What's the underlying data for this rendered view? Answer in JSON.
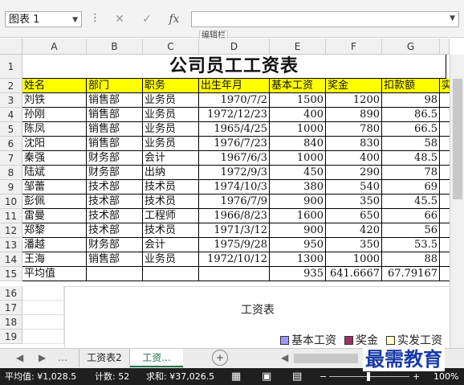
{
  "namebox": "图表 1",
  "formula_tooltip": "编辑栏",
  "formula_buttons": [
    "✕",
    "✓",
    "fx"
  ],
  "columns": [
    "A",
    "B",
    "C",
    "D",
    "E",
    "F",
    "G"
  ],
  "title": "公司员工工资表",
  "headers": [
    "姓名",
    "部门",
    "职务",
    "出生年月",
    "基本工资",
    "奖金",
    "扣款额",
    "实"
  ],
  "rows": [
    [
      "刘铁",
      "销售部",
      "业务员",
      "1970/7/2",
      "1500",
      "1200",
      "98"
    ],
    [
      "孙刚",
      "销售部",
      "业务员",
      "1972/12/23",
      "400",
      "890",
      "86.5"
    ],
    [
      "陈凤",
      "销售部",
      "业务员",
      "1965/4/25",
      "1000",
      "780",
      "66.5"
    ],
    [
      "沈阳",
      "销售部",
      "业务员",
      "1976/7/23",
      "840",
      "830",
      "58"
    ],
    [
      "秦强",
      "财务部",
      "会计",
      "1967/6/3",
      "1000",
      "400",
      "48.5"
    ],
    [
      "陆斌",
      "财务部",
      "出纳",
      "1972/9/3",
      "450",
      "290",
      "78"
    ],
    [
      "邹蕾",
      "技术部",
      "技术员",
      "1974/10/3",
      "380",
      "540",
      "69"
    ],
    [
      "彭佩",
      "技术部",
      "技术员",
      "1976/7/9",
      "900",
      "350",
      "45.5"
    ],
    [
      "雷曼",
      "技术部",
      "工程师",
      "1966/8/23",
      "1600",
      "650",
      "66"
    ],
    [
      "郑黎",
      "技术部",
      "技术员",
      "1971/3/12",
      "900",
      "420",
      "56"
    ],
    [
      "潘越",
      "财务部",
      "会计",
      "1975/9/28",
      "950",
      "350",
      "53.5"
    ],
    [
      "王海",
      "销售部",
      "业务员",
      "1972/10/12",
      "1300",
      "1000",
      "88"
    ]
  ],
  "avg_label": "平均值",
  "avg_values": [
    "935",
    "641.6667",
    "67.79167"
  ],
  "row_numbers": [
    "1",
    "2",
    "3",
    "4",
    "5",
    "6",
    "7",
    "8",
    "9",
    "10",
    "11",
    "12",
    "13",
    "14",
    "15",
    "16",
    "17",
    "18",
    "19"
  ],
  "chart": {
    "title": "工资表",
    "legend": [
      {
        "label": "基本工资",
        "color": "#9999ff"
      },
      {
        "label": "奖金",
        "color": "#993366"
      },
      {
        "label": "实发工资",
        "color": "#ffffcc"
      }
    ]
  },
  "sheet_tabs": [
    "工资表2",
    "工资..."
  ],
  "status": {
    "average": "平均值: ¥1,028.5",
    "count": "计数: 52",
    "sum": "求和: ¥37,026.5",
    "zoom": "100%"
  },
  "watermark": "最需教育"
}
